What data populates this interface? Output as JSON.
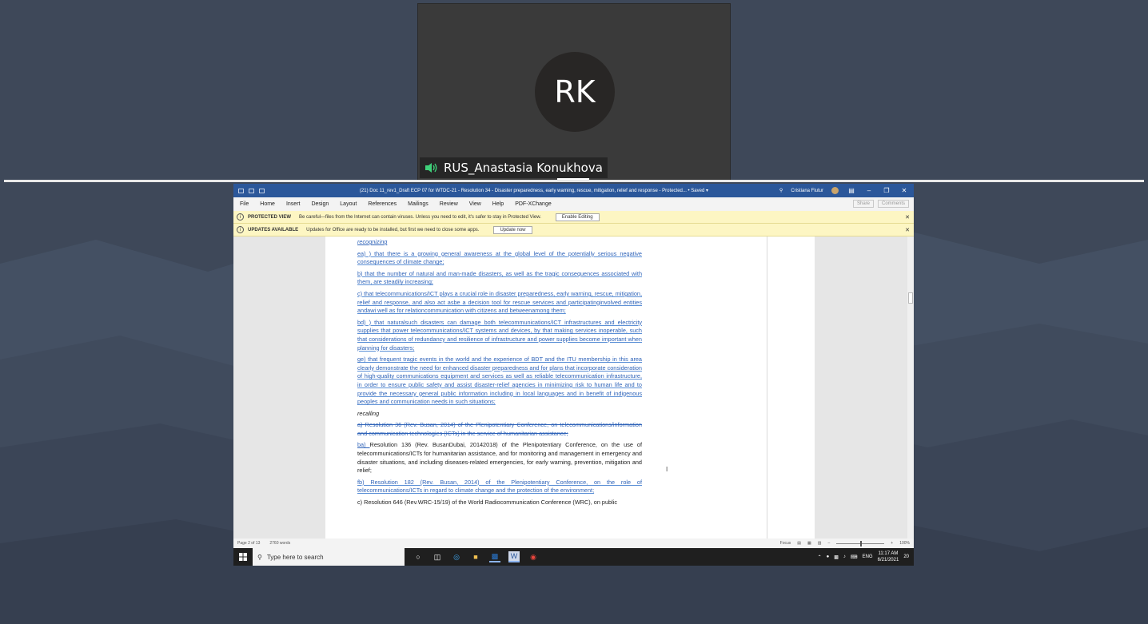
{
  "participant": {
    "initials": "RK",
    "name": "RUS_Anastasia Konukhova"
  },
  "word": {
    "title": "(21) Doc 11_rev1_Draft ECP 07 for WTDC-21 - Resolution 34 - Disaster preparedness, early warning, rescue, mitigation, relief and response  -  Protected...  •  Saved  ▾",
    "user": "Cristiana Flutur",
    "menu": [
      "File",
      "Home",
      "Insert",
      "Design",
      "Layout",
      "References",
      "Mailings",
      "Review",
      "View",
      "Help",
      "PDF-XChange"
    ],
    "share": "Share",
    "comments": "Comments",
    "protected": {
      "label": "PROTECTED VIEW",
      "message": "Be careful—files from the Internet can contain viruses. Unless you need to edit, it's safer to stay in Protected View.",
      "button": "Enable Editing"
    },
    "updates": {
      "label": "UPDATES AVAILABLE",
      "message": "Updates for Office are ready to be installed, but first we need to close some apps.",
      "button": "Update now"
    },
    "doc": {
      "heading_recognizing": "recognizing",
      "p_a": "ea) ) that there is a growing general awareness at the global level of the potentially serious negative consequences of climate change;",
      "p_b": "b) that the number of natural and man-made disasters, as well as the tragic consequences associated with them, are steadily increasing;",
      "p_c": "c) that telecommunications/ICT plays a crucial role in disaster preparedness, early warning, rescue, mitigation, relief and response, and also act asbe a decision tool for rescue services and participatinginvolved entities andawi well as for relationcommunication with citizens and betweenamong them;",
      "p_d": "bd) ) that naturalsuch disasters can damage both telecommunications/ICT infrastructures and electricity supplies that power telecommunications/ICT systems and devices, by that making services inoperable, such that considerations of redundancy and resilience of infrastructure and power supplies become important when planning for disasters;",
      "p_e": "ge) that frequent tragic events in the world and the experience of BDT and the ITU membership in this area clearly demonstrate the need for enhanced disaster preparedness and for plans that incorporate consideration of high-quality communications equipment and services as well as reliable telecommunication infrastructure, in order to ensure public safety and assist disaster-relief agencies in minimizing risk to human life and to provide the necessary general public information including in local languages and in benefit of indigenous peoples and communication needs in such situations;",
      "heading_recalling": "recalling",
      "r_a": "a) Resolution 36 (Rev. Busan, 2014) of the Plenipotentiary Conference, on telecommunications/information and communication technologies (ICTs) in the service of humanitarian assistance;",
      "r_b_prefix": "ba) ",
      "r_b": "Resolution 136 (Rev. BusanDubai, 20142018) of the Plenipotentiary Conference, on the use of telecommunications/ICTs for humanitarian assistance, and for monitoring and management in emergency and disaster situations, and including diseases-related emergencies, for early warning, prevention, mitigation and relief;",
      "r_c": "fb) Resolution 182 (Rev. Busan, 2014) of the Plenipotentiary Conference, on the role of telecommunications/ICTs in regard to climate change and the protection of the environment;",
      "r_d": "c) Resolution 646 (Rev.WRC-15/19) of the World Radiocommunication Conference (WRC), on public"
    },
    "status": {
      "page": "Page 2 of 13",
      "words": "2760 words",
      "focus": "Focus",
      "zoom": "100%"
    }
  },
  "taskbar": {
    "search_placeholder": "Type here to search",
    "lang": "ENG",
    "time": "11:17 AM",
    "date": "6/21/2021",
    "notif": "20"
  }
}
